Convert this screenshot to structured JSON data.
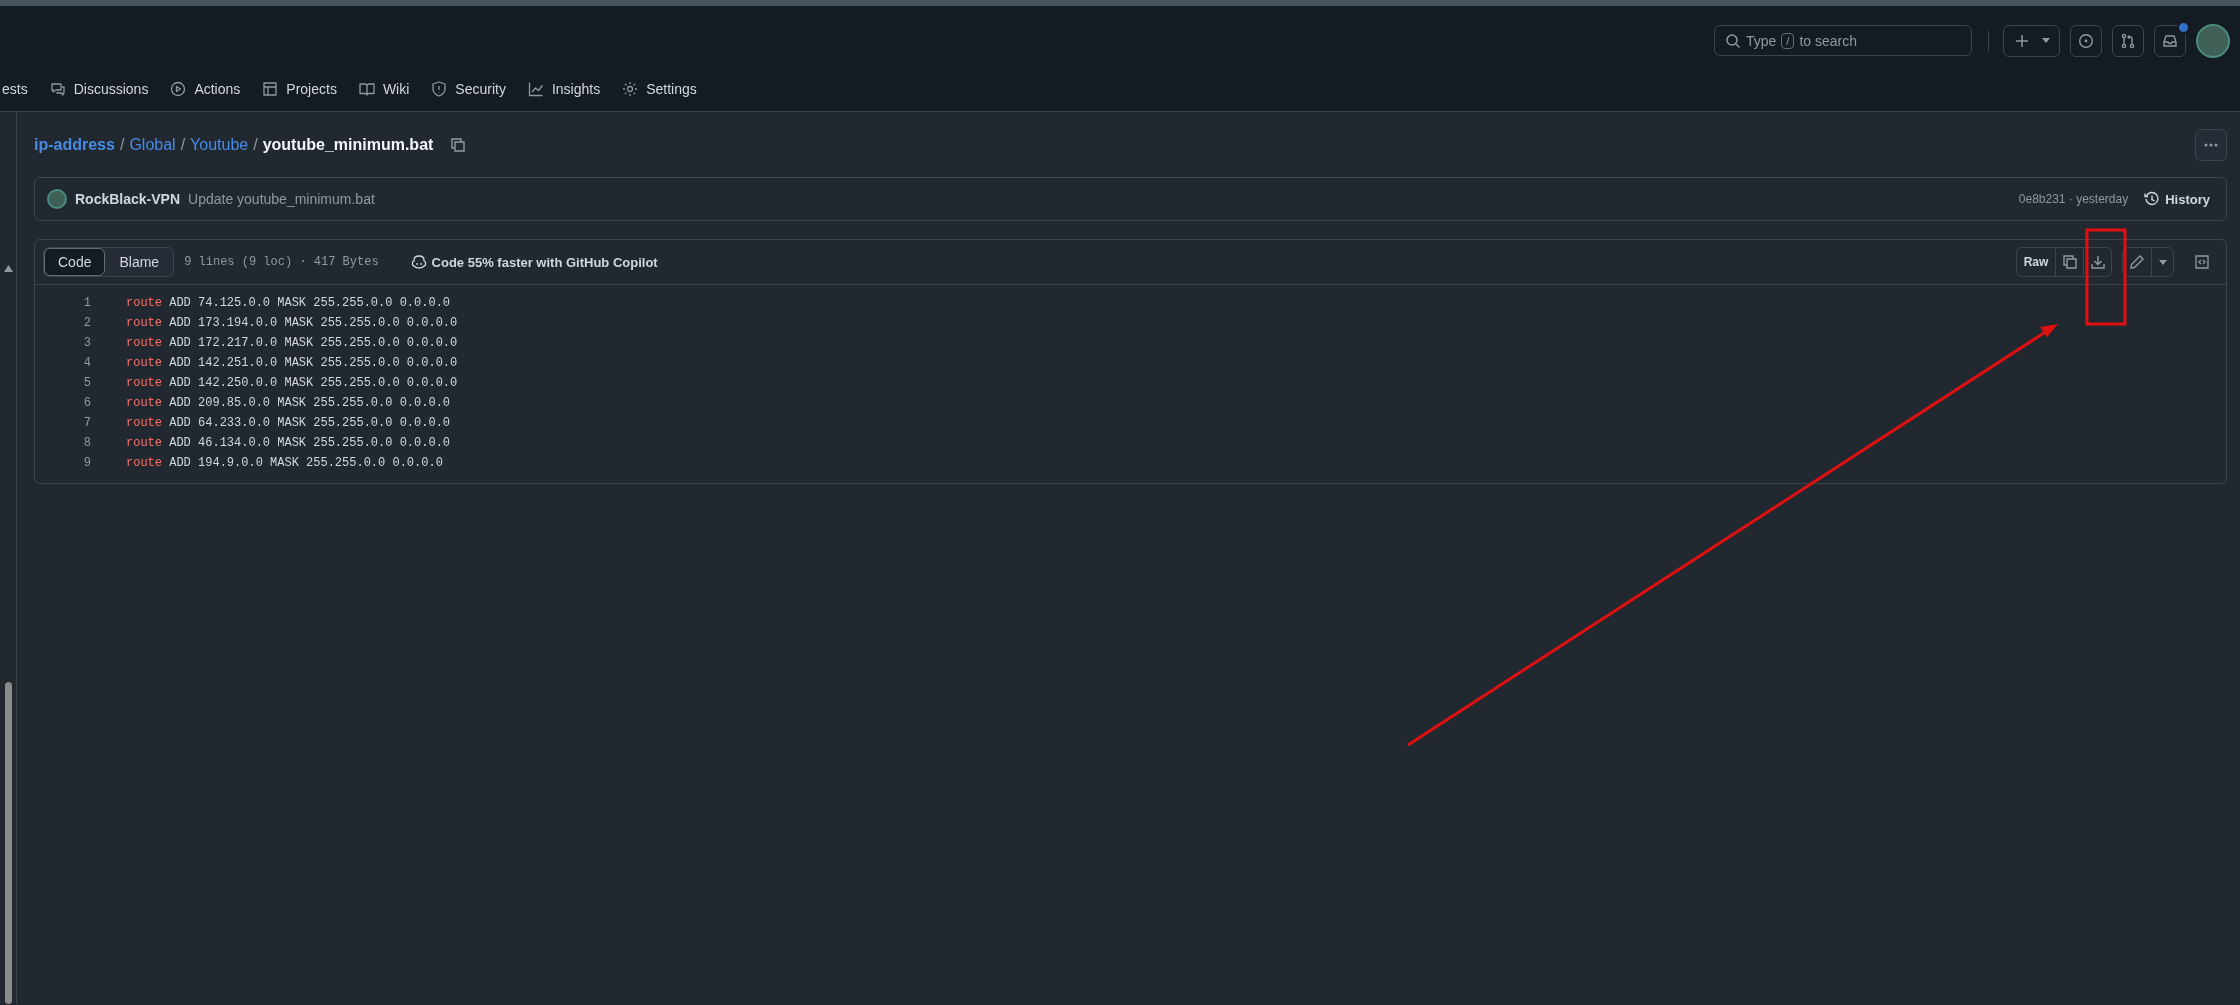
{
  "header": {
    "search": {
      "placeholder_before": "Type",
      "shortcut_key": "/",
      "placeholder_after": "to search"
    },
    "notifications_unread": true
  },
  "nav": [
    {
      "label": "ests"
    },
    {
      "label": "Discussions"
    },
    {
      "label": "Actions"
    },
    {
      "label": "Projects"
    },
    {
      "label": "Wiki"
    },
    {
      "label": "Security"
    },
    {
      "label": "Insights"
    },
    {
      "label": "Settings"
    }
  ],
  "breadcrumb": {
    "links": [
      "ip-address",
      "Global",
      "Youtube"
    ],
    "separator": "/",
    "file": "youtube_minimum.bat"
  },
  "commit": {
    "author": "RockBlack-VPN",
    "message": "Update youtube_minimum.bat",
    "sha_time": "0e8b231 · yesterday",
    "history": "History"
  },
  "file": {
    "tabs": [
      {
        "label": "Code",
        "selected": true
      },
      {
        "label": "Blame",
        "selected": false
      }
    ],
    "info": "9 lines (9 loc) · 417 Bytes",
    "copilot": "Code 55% faster with GitHub Copilot",
    "raw": "Raw",
    "lines": [
      {
        "number": "1",
        "keyword": "route",
        "text": "ADD 74.125.0.0 MASK 255.255.0.0 0.0.0.0"
      },
      {
        "number": "2",
        "keyword": "route",
        "text": "ADD 173.194.0.0 MASK 255.255.0.0 0.0.0.0"
      },
      {
        "number": "3",
        "keyword": "route",
        "text": "ADD 172.217.0.0 MASK 255.255.0.0 0.0.0.0"
      },
      {
        "number": "4",
        "keyword": "route",
        "text": "ADD 142.251.0.0 MASK 255.255.0.0 0.0.0.0"
      },
      {
        "number": "5",
        "keyword": "route",
        "text": "ADD 142.250.0.0 MASK 255.255.0.0 0.0.0.0"
      },
      {
        "number": "6",
        "keyword": "route",
        "text": "ADD 209.85.0.0 MASK 255.255.0.0 0.0.0.0"
      },
      {
        "number": "7",
        "keyword": "route",
        "text": "ADD 64.233.0.0 MASK 255.255.0.0 0.0.0.0"
      },
      {
        "number": "8",
        "keyword": "route",
        "text": "ADD 46.134.0.0 MASK 255.255.0.0 0.0.0.0"
      },
      {
        "number": "9",
        "keyword": "route",
        "text": "ADD 194.9.0.0 MASK 255.255.0.0 0.0.0.0"
      }
    ]
  }
}
